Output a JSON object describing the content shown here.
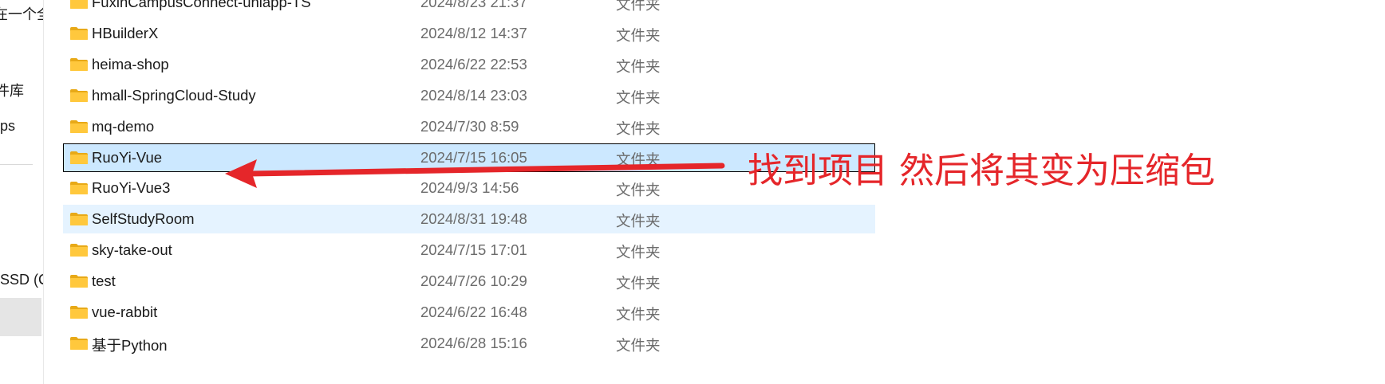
{
  "nav": {
    "items": [
      {
        "label": "在一个全"
      },
      {
        "label": "件库"
      },
      {
        "label": "ps"
      },
      {
        "label": "SSD (C"
      }
    ]
  },
  "files": [
    {
      "name": "FuxinCampusConnect-uniapp-TS",
      "date": "2024/8/23 21:37",
      "type": "文件夹",
      "state": "normal"
    },
    {
      "name": "HBuilderX",
      "date": "2024/8/12 14:37",
      "type": "文件夹",
      "state": "normal"
    },
    {
      "name": "heima-shop",
      "date": "2024/6/22 22:53",
      "type": "文件夹",
      "state": "normal"
    },
    {
      "name": "hmall-SpringCloud-Study",
      "date": "2024/8/14 23:03",
      "type": "文件夹",
      "state": "normal"
    },
    {
      "name": "mq-demo",
      "date": "2024/7/30 8:59",
      "type": "文件夹",
      "state": "normal"
    },
    {
      "name": "RuoYi-Vue",
      "date": "2024/7/15 16:05",
      "type": "文件夹",
      "state": "selected"
    },
    {
      "name": "RuoYi-Vue3",
      "date": "2024/9/3 14:56",
      "type": "文件夹",
      "state": "normal"
    },
    {
      "name": "SelfStudyRoom",
      "date": "2024/8/31 19:48",
      "type": "文件夹",
      "state": "hover"
    },
    {
      "name": "sky-take-out",
      "date": "2024/7/15 17:01",
      "type": "文件夹",
      "state": "normal"
    },
    {
      "name": "test",
      "date": "2024/7/26 10:29",
      "type": "文件夹",
      "state": "normal"
    },
    {
      "name": "vue-rabbit",
      "date": "2024/6/22 16:48",
      "type": "文件夹",
      "state": "normal"
    },
    {
      "name": "基于Python",
      "date": "2024/6/28 15:16",
      "type": "文件夹",
      "state": "normal"
    }
  ],
  "annotation": {
    "text": "找到项目 然后将其变为压缩包",
    "color": "#e5262a"
  },
  "colors": {
    "selected_bg": "#cce8ff",
    "hover_bg": "#e5f3ff",
    "folder_yellow": "#ffc83d"
  }
}
